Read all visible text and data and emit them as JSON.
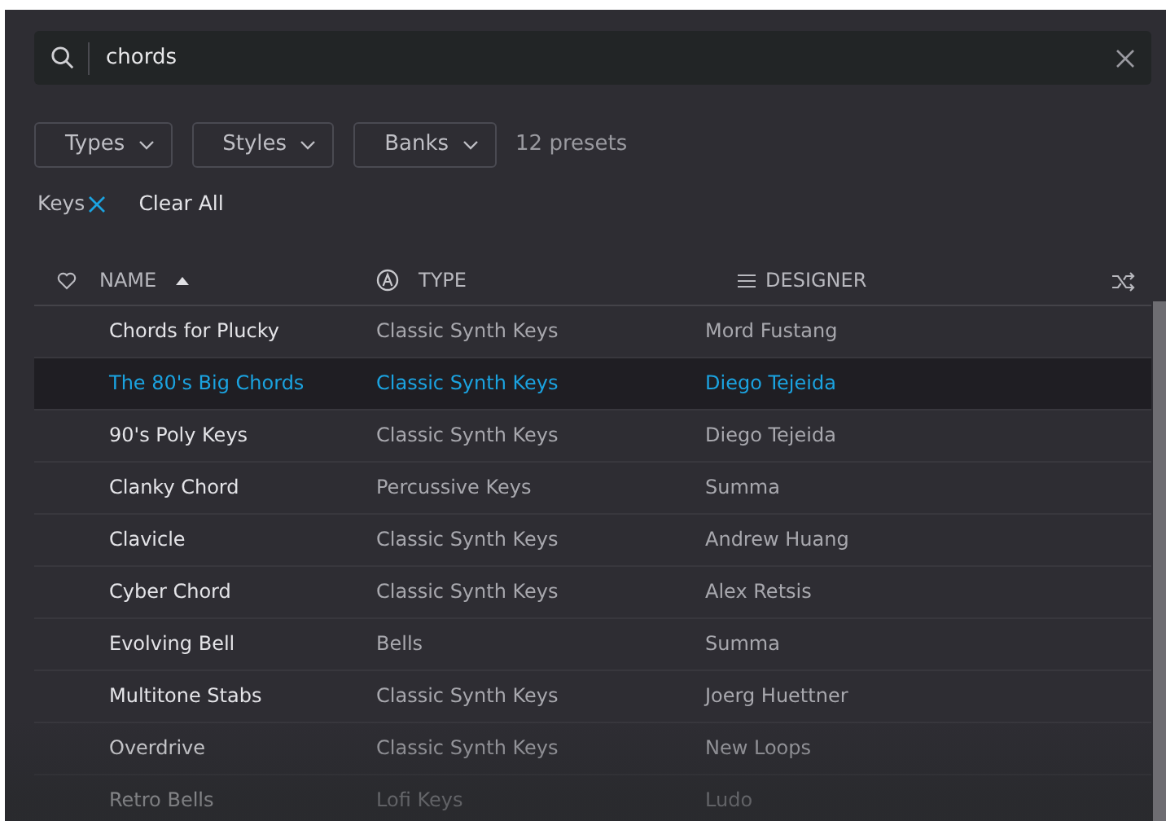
{
  "search": {
    "value": "chords"
  },
  "filters": [
    {
      "label": "Types"
    },
    {
      "label": "Styles"
    },
    {
      "label": "Banks"
    }
  ],
  "preset_count": "12 presets",
  "active_tags": [
    {
      "label": "Keys"
    }
  ],
  "clear_all": "Clear All",
  "columns": [
    {
      "kind": "name",
      "label": "NAME",
      "sorted": true
    },
    {
      "kind": "type",
      "label": "TYPE",
      "sorted": false
    },
    {
      "kind": "designer",
      "label": "DESIGNER",
      "sorted": false
    }
  ],
  "rows": [
    {
      "name": "Chords for Plucky",
      "type": "Classic Synth Keys",
      "designer": "Mord Fustang",
      "selected": false
    },
    {
      "name": "The 80's Big Chords",
      "type": "Classic Synth Keys",
      "designer": "Diego Tejeida",
      "selected": true
    },
    {
      "name": "90's Poly Keys",
      "type": "Classic Synth Keys",
      "designer": "Diego Tejeida",
      "selected": false
    },
    {
      "name": "Clanky Chord",
      "type": "Percussive Keys",
      "designer": "Summa",
      "selected": false
    },
    {
      "name": "Clavicle",
      "type": "Classic Synth Keys",
      "designer": "Andrew Huang",
      "selected": false
    },
    {
      "name": "Cyber Chord",
      "type": "Classic Synth Keys",
      "designer": "Alex Retsis",
      "selected": false
    },
    {
      "name": "Evolving Bell",
      "type": "Bells",
      "designer": "Summa",
      "selected": false
    },
    {
      "name": "Multitone Stabs",
      "type": "Classic Synth Keys",
      "designer": "Joerg Huettner",
      "selected": false
    },
    {
      "name": "Overdrive",
      "type": "Classic Synth Keys",
      "designer": "New Loops",
      "selected": false
    },
    {
      "name": "Retro Bells",
      "type": "Lofi Keys",
      "designer": "Ludo",
      "selected": false
    }
  ]
}
